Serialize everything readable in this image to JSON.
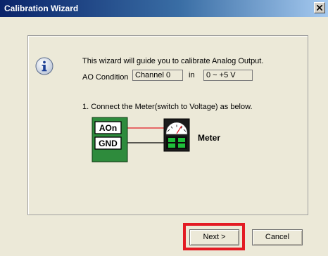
{
  "window": {
    "title": "Calibration Wizard"
  },
  "content": {
    "intro": "This wizard will guide you to calibrate Analog Output.",
    "ao_condition_label": "AO Condition",
    "channel_value": "Channel 0",
    "in_label": "in",
    "range_value": "0 ~ +5 V",
    "step1": "1.  Connect the Meter(switch to Voltage) as below."
  },
  "diagram": {
    "pin1": "AOn",
    "pin2": "GND",
    "meter_label": "Meter",
    "colors": {
      "board": "#2e8b3c",
      "wire_signal": "#e31b23",
      "wire_ground": "#000000"
    }
  },
  "buttons": {
    "next": "Next >",
    "cancel": "Cancel"
  },
  "icons": {
    "info": "info-icon",
    "close": "close-icon"
  },
  "highlight_color": "#e31b23"
}
